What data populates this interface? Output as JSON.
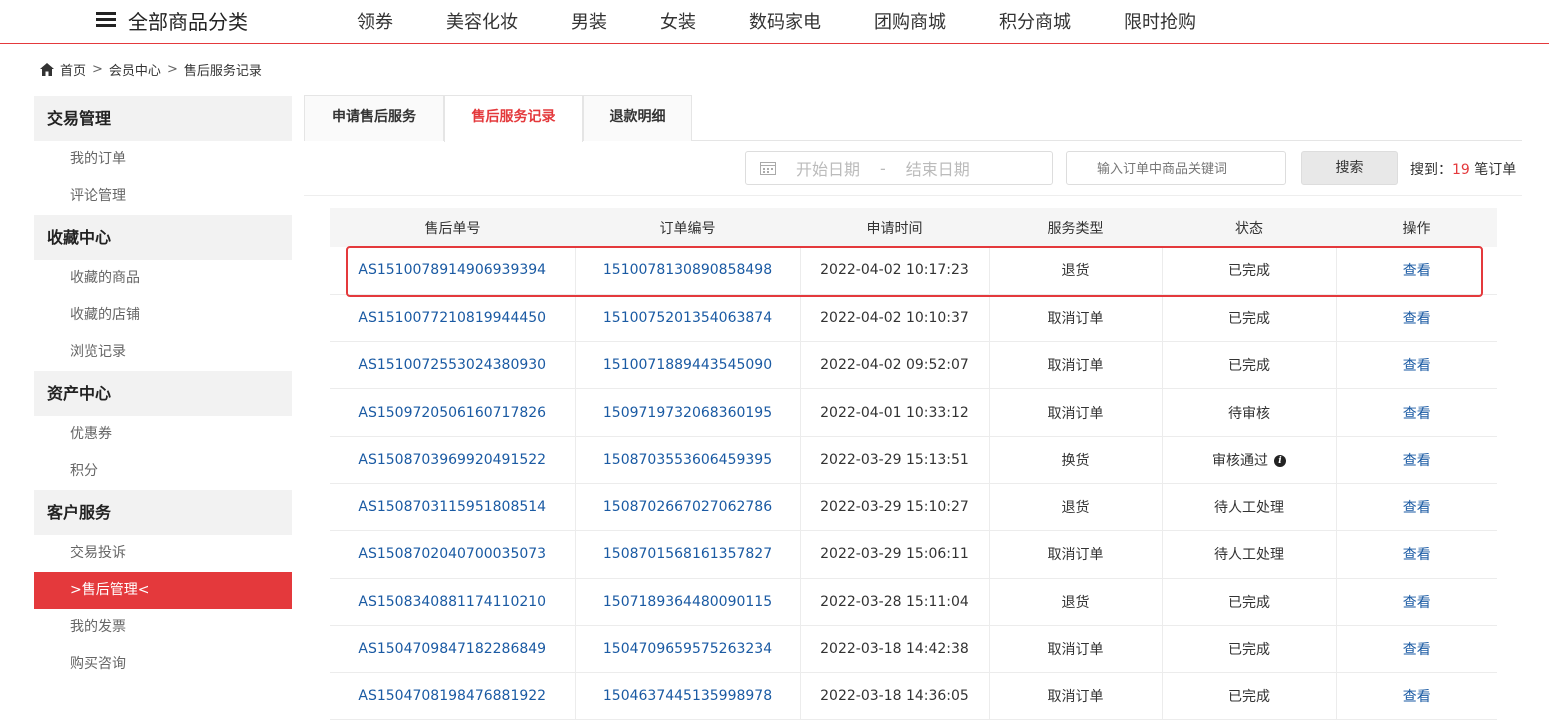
{
  "topnav": {
    "all_categories": "全部商品分类",
    "links": [
      "领券",
      "美容化妆",
      "男装",
      "女装",
      "数码家电",
      "团购商城",
      "积分商城",
      "限时抢购"
    ]
  },
  "breadcrumb": {
    "home": "首页",
    "sep": ">",
    "member": "会员中心",
    "current": "售后服务记录"
  },
  "sidebar": {
    "groups": [
      {
        "title": "交易管理",
        "items": [
          "我的订单",
          "评论管理"
        ]
      },
      {
        "title": "收藏中心",
        "items": [
          "收藏的商品",
          "收藏的店铺",
          "浏览记录"
        ]
      },
      {
        "title": "资产中心",
        "items": [
          "优惠券",
          "积分"
        ]
      },
      {
        "title": "客户服务",
        "items": [
          "交易投诉",
          ">售后管理<",
          "我的发票",
          "购买咨询"
        ]
      }
    ],
    "active_item": ">售后管理<"
  },
  "tabs": [
    "申请售后服务",
    "售后服务记录",
    "退款明细"
  ],
  "active_tab": "售后服务记录",
  "search": {
    "start_placeholder": "开始日期",
    "date_sep": "-",
    "end_placeholder": "结束日期",
    "keyword_placeholder": "输入订单中商品关键词",
    "button": "搜索",
    "result_prefix": "搜到：",
    "result_count": "19",
    "result_suffix": " 笔订单"
  },
  "table": {
    "headers": [
      "售后单号",
      "订单编号",
      "申请时间",
      "服务类型",
      "状态",
      "操作"
    ],
    "rows": [
      [
        "AS1510078914906939394",
        "1510078130890858498",
        "2022-04-02 10:17:23",
        "退货",
        "已完成",
        "查看"
      ],
      [
        "AS1510077210819944450",
        "1510075201354063874",
        "2022-04-02 10:10:37",
        "取消订单",
        "已完成",
        "查看"
      ],
      [
        "AS1510072553024380930",
        "1510071889443545090",
        "2022-04-02 09:52:07",
        "取消订单",
        "已完成",
        "查看"
      ],
      [
        "AS1509720506160717826",
        "1509719732068360195",
        "2022-04-01 10:33:12",
        "取消订单",
        "待审核",
        "查看"
      ],
      [
        "AS1508703969920491522",
        "1508703553606459395",
        "2022-03-29 15:13:51",
        "换货",
        "审核通过",
        "查看"
      ],
      [
        "AS1508703115951808514",
        "1508702667027062786",
        "2022-03-29 15:10:27",
        "退货",
        "待人工处理",
        "查看"
      ],
      [
        "AS1508702040700035073",
        "1508701568161357827",
        "2022-03-29 15:06:11",
        "取消订单",
        "待人工处理",
        "查看"
      ],
      [
        "AS1508340881174110210",
        "1507189364480090115",
        "2022-03-28 15:11:04",
        "退货",
        "已完成",
        "查看"
      ],
      [
        "AS1504709847182286849",
        "1504709659575263234",
        "2022-03-18 14:42:38",
        "取消订单",
        "已完成",
        "查看"
      ],
      [
        "AS1504708198476881922",
        "1504637445135998978",
        "2022-03-18 14:36:05",
        "取消订单",
        "已完成",
        "查看"
      ]
    ],
    "info_icon_row": 4
  },
  "colors": {
    "accent": "#e4393c",
    "link": "#1a5aa3",
    "header_bg": "#f5f5f5"
  },
  "icons": {
    "menu": "hamburger-icon",
    "home": "home-icon",
    "calendar": "calendar-icon",
    "info": "info-icon"
  }
}
